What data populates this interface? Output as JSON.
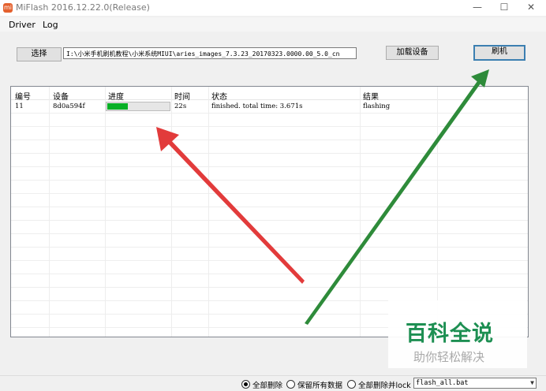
{
  "window": {
    "title": "MiFlash 2016.12.22.0(Release)",
    "icon_label": "mi",
    "minimize": "—",
    "maximize": "☐",
    "close": "✕"
  },
  "menu": {
    "driver": "Driver",
    "log": "Log"
  },
  "toolbar": {
    "select_label": "选择",
    "path_value": "I:\\小米手机刷机教程\\小米系统MIUI\\aries_images_7.3.23_20170323.0000.00_5.0_cn",
    "load_device_label": "加载设备",
    "flash_label": "刷机"
  },
  "table": {
    "headers": [
      "编号",
      "设备",
      "进度",
      "时间",
      "状态",
      "结果"
    ],
    "rows": [
      {
        "id": "11",
        "device": "8d0a594f",
        "progress": 0.33,
        "time": "22s",
        "status": "finished. total time: 3.671s",
        "result": "flashing"
      }
    ]
  },
  "statusbar": {
    "options": [
      "全部删除",
      "保留所有数据",
      "全部删除并lock"
    ],
    "selected_index": 0,
    "script": "flash_all.bat"
  },
  "watermark": {
    "title": "百科全说",
    "subtitle": "助你轻松解决"
  },
  "colors": {
    "progress_fill": "#06b025",
    "red_arrow": "#e23b3b",
    "green_arrow": "#2e8b3a",
    "watermark_green": "#1d8f52"
  }
}
